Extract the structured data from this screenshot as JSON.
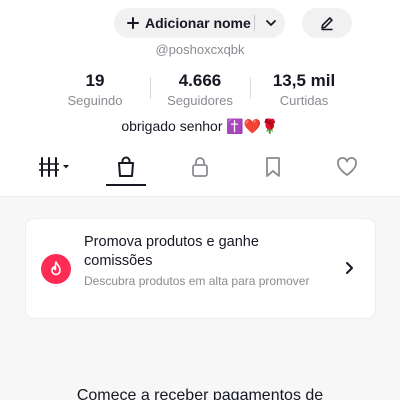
{
  "header": {
    "add_name_label": "Adicionar nome",
    "username": "@poshoxcxqbk"
  },
  "stats": [
    {
      "value": "19",
      "label": "Seguindo"
    },
    {
      "value": "4.666",
      "label": "Seguidores"
    },
    {
      "value": "13,5 mil",
      "label": "Curtidas"
    }
  ],
  "bio": "obrigado senhor ✝️❤️🌹",
  "tabs": {
    "active": "shop",
    "items": [
      "videos-grid",
      "shop",
      "private",
      "saved",
      "liked"
    ]
  },
  "promo": {
    "title": "Promova produtos e ganhe comissões",
    "description": "Descubra produtos em alta para promover"
  },
  "teaser_text": "Comece a receber pagamentos de",
  "colors": {
    "accent": "#fe2c55",
    "text": "#161823",
    "muted": "#8a8b91",
    "chip_bg": "#f1f1f2"
  }
}
